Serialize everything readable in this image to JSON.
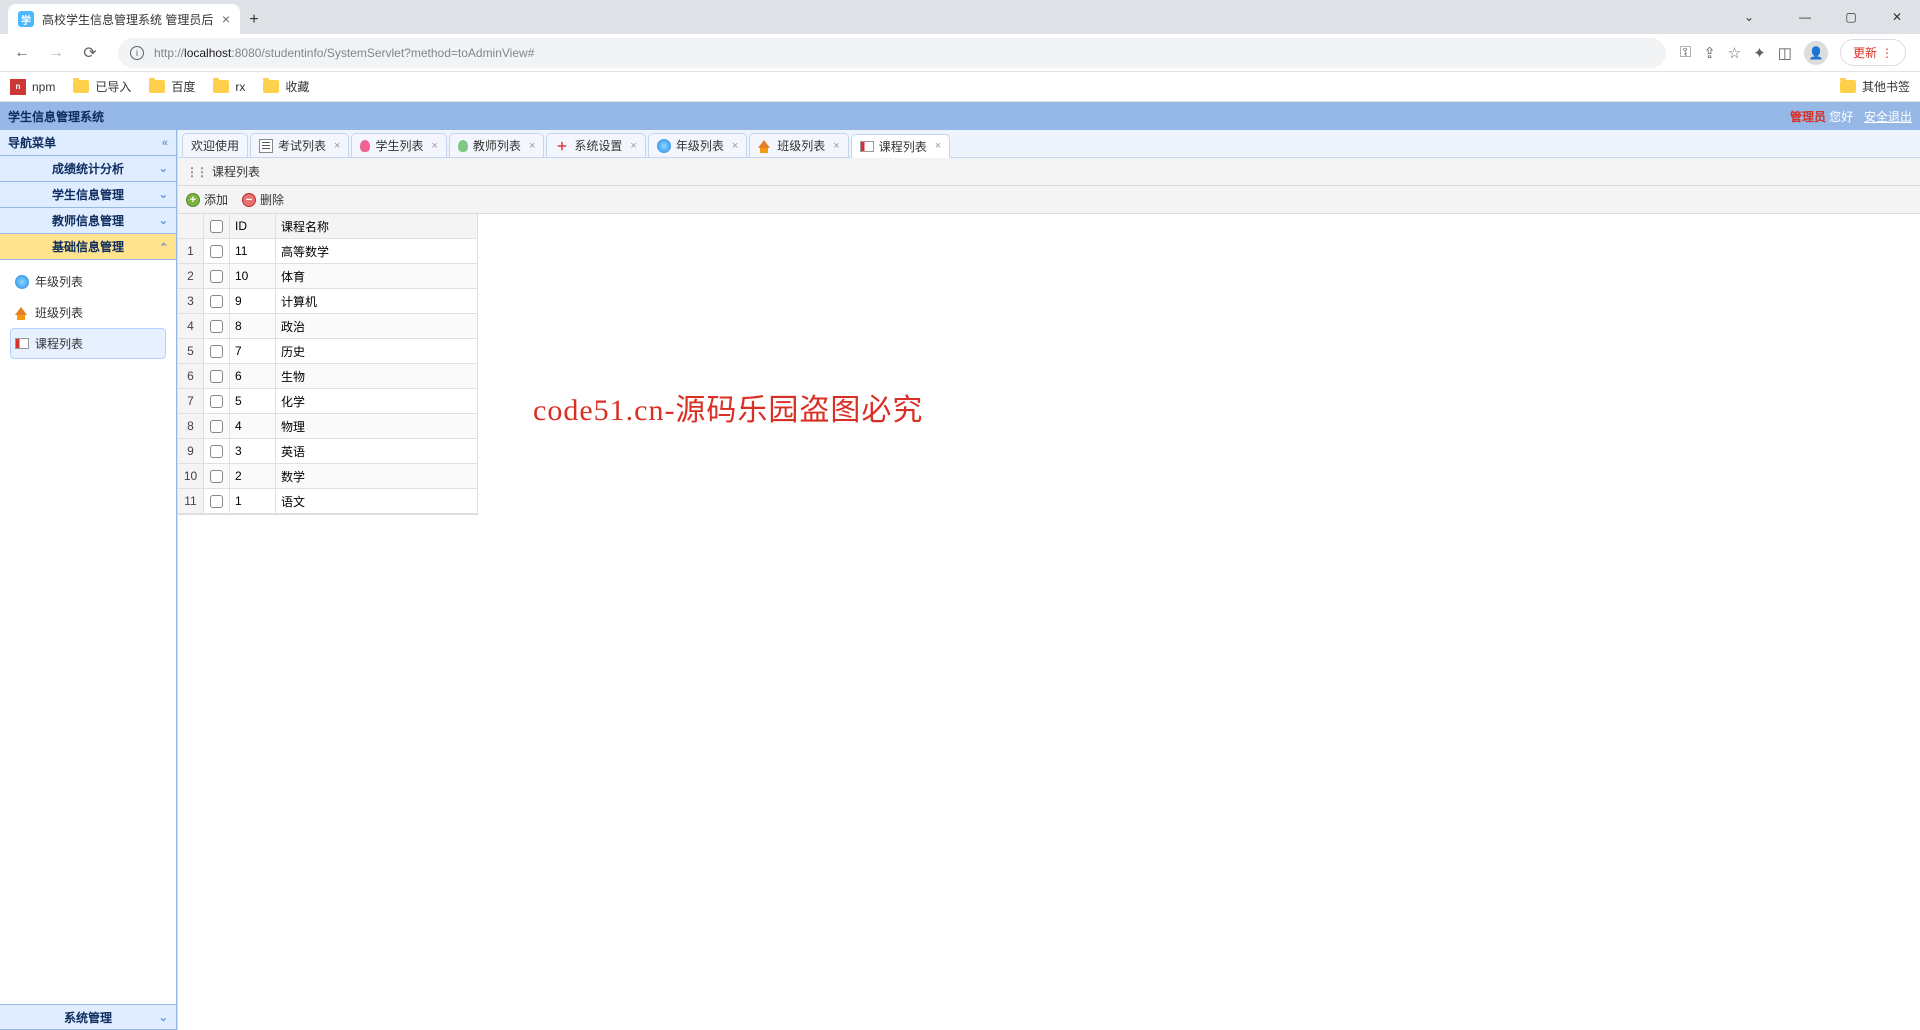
{
  "chrome": {
    "tab_title": "高校学生信息管理系统 管理员后",
    "url_prefix": "http://",
    "url_host": "localhost",
    "url_port_path": ":8080/studentinfo/SystemServlet?method=toAdminView#",
    "update_btn": "更新"
  },
  "bookmarks": {
    "npm": "npm",
    "imported": "已导入",
    "baidu": "百度",
    "rx": "rx",
    "fav": "收藏",
    "other": "其他书签"
  },
  "header": {
    "app_title": "学生信息管理系统",
    "admin": "管理员",
    "greeting": "您好",
    "logout": "安全退出"
  },
  "sidebar": {
    "nav_title": "导航菜单",
    "items": [
      "成绩统计分析",
      "学生信息管理",
      "教师信息管理",
      "基础信息管理"
    ],
    "sub": {
      "grade": "年级列表",
      "class": "班级列表",
      "course": "课程列表"
    },
    "sys_mgmt": "系统管理"
  },
  "tabs": [
    "欢迎使用",
    "考试列表",
    "学生列表",
    "教师列表",
    "系统设置",
    "年级列表",
    "班级列表",
    "课程列表"
  ],
  "panel": {
    "title": "课程列表",
    "add": "添加",
    "delete": "删除"
  },
  "grid": {
    "header_id": "ID",
    "header_name": "课程名称",
    "rows": [
      {
        "n": "1",
        "id": "11",
        "name": "高等数学"
      },
      {
        "n": "2",
        "id": "10",
        "name": "体育"
      },
      {
        "n": "3",
        "id": "9",
        "name": "计算机"
      },
      {
        "n": "4",
        "id": "8",
        "name": "政治"
      },
      {
        "n": "5",
        "id": "7",
        "name": "历史"
      },
      {
        "n": "6",
        "id": "6",
        "name": "生物"
      },
      {
        "n": "7",
        "id": "5",
        "name": "化学"
      },
      {
        "n": "8",
        "id": "4",
        "name": "物理"
      },
      {
        "n": "9",
        "id": "3",
        "name": "英语"
      },
      {
        "n": "10",
        "id": "2",
        "name": "数学"
      },
      {
        "n": "11",
        "id": "1",
        "name": "语文"
      }
    ]
  },
  "watermark": "code51.cn-源码乐园盗图必究"
}
